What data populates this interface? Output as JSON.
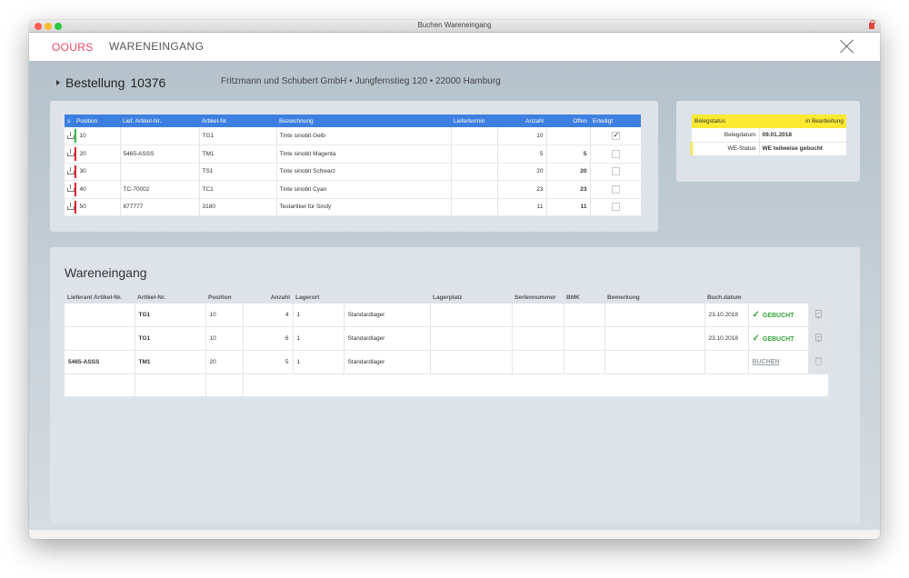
{
  "window": {
    "title": "Buchen Wareneingang"
  },
  "header": {
    "logo": "OOURS",
    "title": "WARENEINGANG"
  },
  "order": {
    "label": "Bestellung",
    "number": "10376",
    "supplier": "Fritzmann und Schubert GmbH • Jungfernstieg 120 • 22000 Hamburg"
  },
  "order_table": {
    "headers": [
      "s",
      "Position",
      "Lief. Artikel-Nr.",
      "Artikel-Nr.",
      "Bezeichnung",
      "Liefertermin",
      "Anzahl",
      "Offen",
      "Erledigt"
    ],
    "rows": [
      {
        "position": "10",
        "lief_nr": "",
        "artikel": "TG1",
        "bez": "Tinte sinobit Gelb",
        "termin": "",
        "anzahl": "10",
        "offen": "",
        "erledigt": true,
        "color": "#35c04a"
      },
      {
        "position": "20",
        "lief_nr": "5465-ASSS",
        "artikel": "TM1",
        "bez": "Tinte sinobit Magenta",
        "termin": "",
        "anzahl": "5",
        "offen": "5",
        "erledigt": false,
        "color": "#e0262b"
      },
      {
        "position": "30",
        "lief_nr": "",
        "artikel": "TS1",
        "bez": "Tinte sinobit Schwarz",
        "termin": "",
        "anzahl": "20",
        "offen": "20",
        "erledigt": false,
        "color": "#e0262b"
      },
      {
        "position": "40",
        "lief_nr": "TC-70002",
        "artikel": "TC1",
        "bez": "Tinte sinobit Cyan",
        "termin": "",
        "anzahl": "23",
        "offen": "23",
        "erledigt": false,
        "color": "#e0262b"
      },
      {
        "position": "50",
        "lief_nr": "877777",
        "artikel": "3180",
        "bez": "Testartikel für Sindy",
        "termin": "",
        "anzahl": "11",
        "offen": "11",
        "erledigt": false,
        "color": "#e0262b"
      }
    ]
  },
  "status": {
    "belegstatus_label": "Belegstatus",
    "belegstatus_value": "in Bearbeitung",
    "belegdatum_label": "Belegdatum",
    "belegdatum_value": "09.01.2018",
    "we_label": "WE-Status",
    "we_value": "WE teilweise gebucht"
  },
  "wareneingang": {
    "title": "Wareneingang",
    "headers": [
      "Lieferant Artikel-Nr.",
      "Artikel-Nr.",
      "Position",
      "Anzahl",
      "Lagerort",
      "",
      "Lagerplatz",
      "Serlennummer",
      "BMK",
      "Bemerkung",
      "Buch.datum",
      "",
      ""
    ],
    "rows": [
      {
        "lief_nr": "",
        "artikel": "TG1",
        "position": "10",
        "anzahl": "4",
        "lagerort_nr": "1",
        "lagerort": "Standardlager",
        "lagerplatz": "",
        "serie": "",
        "bmk": "",
        "bemerkung": "",
        "datum": "23.10.2018",
        "status": "GEBUCHT",
        "booked": true
      },
      {
        "lief_nr": "",
        "artikel": "TG1",
        "position": "10",
        "anzahl": "6",
        "lagerort_nr": "1",
        "lagerort": "Standardlager",
        "lagerplatz": "",
        "serie": "",
        "bmk": "",
        "bemerkung": "",
        "datum": "23.10.2018",
        "status": "GEBUCHT",
        "booked": true
      },
      {
        "lief_nr": "5465-ASSS",
        "artikel": "TM1",
        "position": "20",
        "anzahl": "5",
        "lagerort_nr": "1",
        "lagerort": "Standardlager",
        "lagerplatz": "",
        "serie": "",
        "bmk": "",
        "bemerkung": "",
        "datum": "",
        "status": "BUCHEN",
        "booked": false
      }
    ]
  },
  "colors": {
    "accent": "#3d7fe0",
    "logo": "#e8466a",
    "ok": "#37a33c",
    "warn": "#fce931",
    "alert": "#e0262b"
  }
}
